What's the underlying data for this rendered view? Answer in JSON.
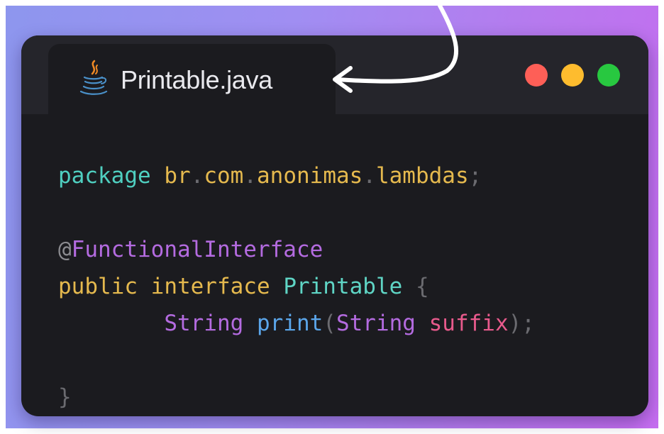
{
  "window": {
    "tab": {
      "filename": "Printable.java",
      "icon": "java-coffee-cup-icon"
    },
    "traffic_lights": {
      "red": "#fe5f57",
      "yellow": "#febc2e",
      "green": "#28c840"
    }
  },
  "code": {
    "line1": {
      "keyword": "package",
      "seg1": "br",
      "seg2": "com",
      "seg3": "anonimas",
      "seg4": "lambdas",
      "end": ";"
    },
    "line3": {
      "at": "@",
      "annotation": "FunctionalInterface"
    },
    "line4": {
      "mod": "public",
      "kw": "interface",
      "name": "Printable",
      "brace": "{"
    },
    "line5": {
      "indent": "        ",
      "ret": "String",
      "method": "print",
      "open": "(",
      "ptype": "String",
      "pname": "suffix",
      "close": ");"
    },
    "line7": {
      "brace": "}"
    }
  }
}
